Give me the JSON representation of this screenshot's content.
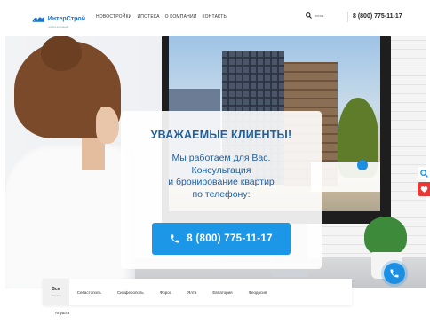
{
  "header": {
    "logo_text": "ИнтерСтрой",
    "logo_sub": "группа компаний",
    "nav": [
      "НОВОСТРОЙКИ",
      "ИПОТЕКА",
      "О КОМПАНИИ",
      "КОНТАКТЫ"
    ],
    "search_placeholder": "поиск",
    "phone": "8 (800) 775-11-17"
  },
  "hero": {
    "title": "УВАЖАЕМЫЕ КЛИЕНТЫ!",
    "text": "Мы работаем для Вас.\nКонсультация\nи бронирование квартир\nпо телефону:",
    "call_button": "8 (800) 775-11-17"
  },
  "tabs": {
    "items": [
      {
        "label": "Все",
        "sub": "объекты",
        "active": true
      },
      {
        "label": "Севастополь"
      },
      {
        "label": "Симферополь"
      },
      {
        "label": "Форос"
      },
      {
        "label": "Ялта"
      },
      {
        "label": "Евпатория"
      },
      {
        "label": "Феодосия"
      }
    ],
    "extra": "Алушта"
  },
  "colors": {
    "accent": "#1c97e8",
    "title_blue": "#1e5f9c",
    "heart_red": "#e53935"
  },
  "icons": {
    "search": "search-icon",
    "phone": "phone-icon",
    "heart": "heart-icon"
  }
}
